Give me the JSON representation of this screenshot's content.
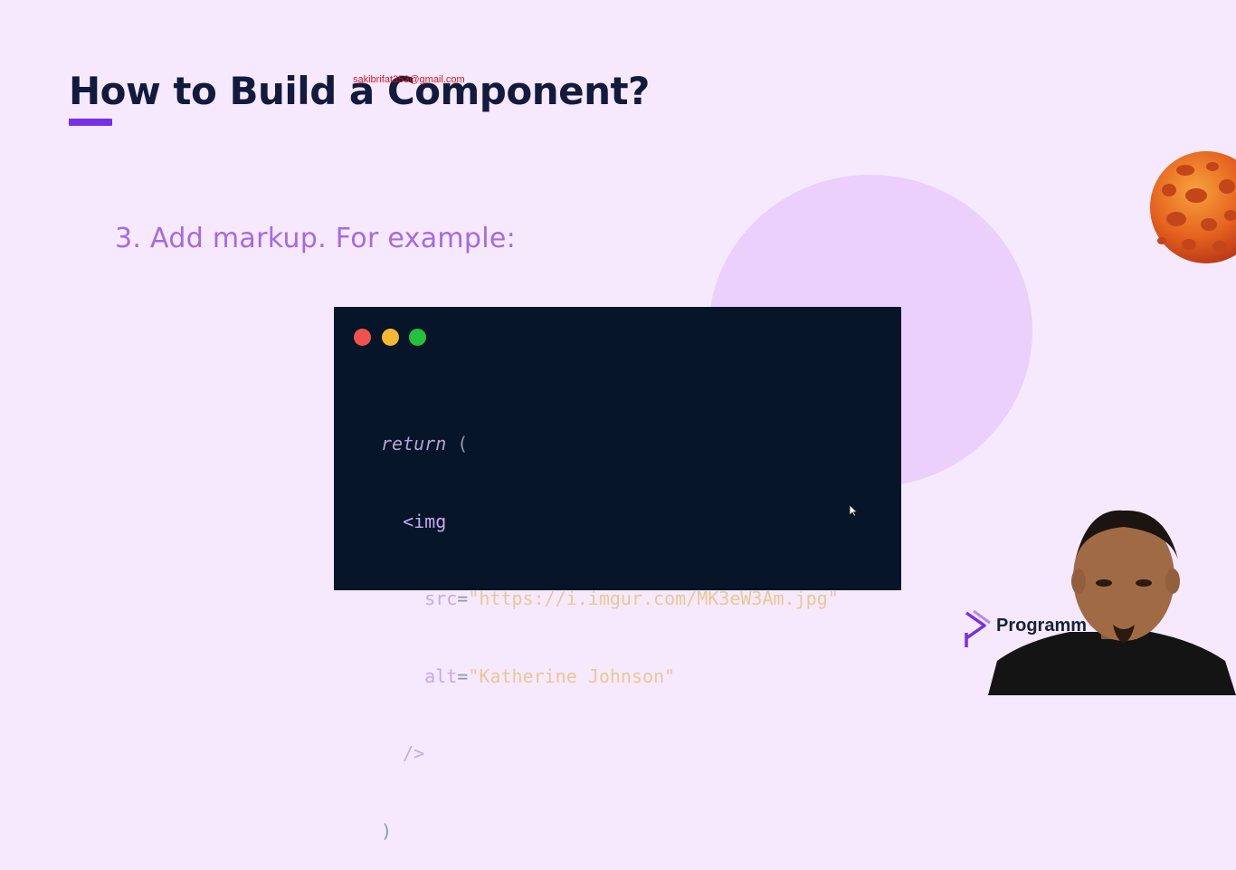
{
  "slide": {
    "title": "How to Build a Component?",
    "watermark": "sakibrifat353@gmail.com",
    "step": "3. Add markup. For example:"
  },
  "code_window": {
    "lines": [
      {
        "indent": "",
        "kw": "return",
        "rest": " ("
      },
      {
        "indent": "  ",
        "tag": "<img"
      },
      {
        "indent": "    ",
        "attr": "src",
        "eq": "=",
        "str": "\"https://i.imgur.com/MK3eW3Am.jpg\""
      },
      {
        "indent": "    ",
        "attr": "alt",
        "eq": "=",
        "str": "\"Katherine Johnson\""
      },
      {
        "indent": "  ",
        "tag": "/>"
      },
      {
        "indent": "",
        "punc": ")"
      }
    ]
  },
  "branding": {
    "name": "Programm"
  },
  "colors": {
    "background": "#f6e9fd",
    "title": "#121a3d",
    "accent": "#7a2ee6",
    "step_text": "#a769e6",
    "code_bg": "#061527",
    "string": "#e8c896"
  },
  "icons": [
    "window-close-dot",
    "window-minimize-dot",
    "window-maximize-dot",
    "mouse-cursor-icon",
    "brand-logo-icon"
  ]
}
